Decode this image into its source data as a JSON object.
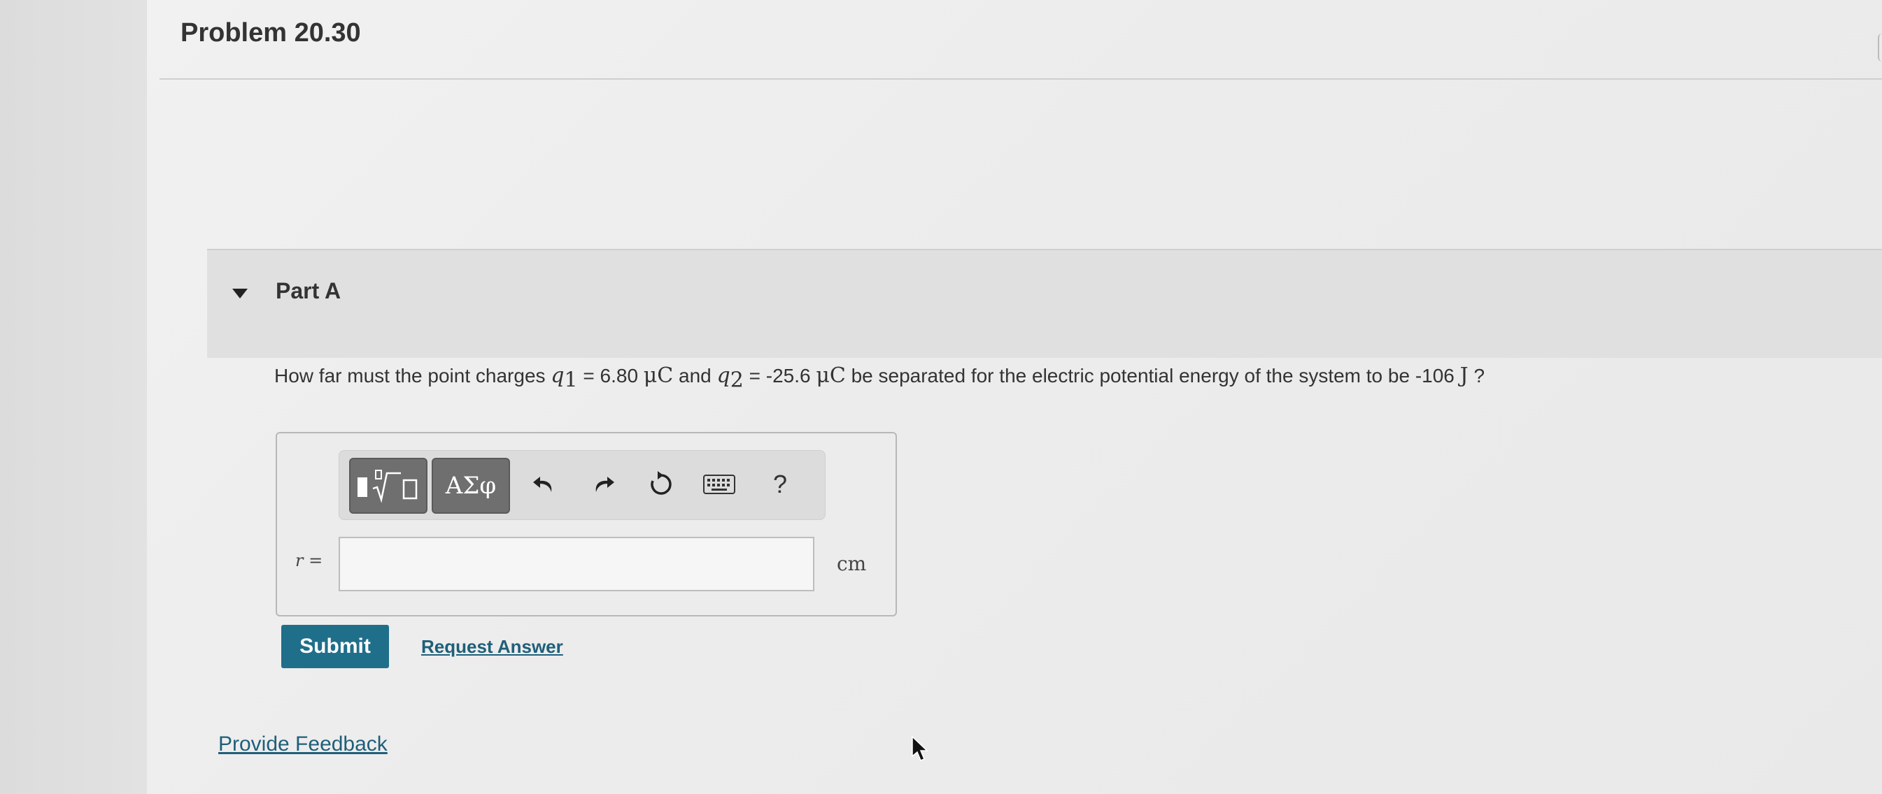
{
  "problem": {
    "title": "Problem 20.30"
  },
  "part": {
    "title": "Part A"
  },
  "question": {
    "intro": "How far must the point charges ",
    "q1_symbol": "q",
    "q1_sub": "1",
    "eq1": " = 6.80 ",
    "unit_mu": "μC",
    "mid": " and ",
    "q2_symbol": "q",
    "q2_sub": "2",
    "eq2": " = -25.6 ",
    "unit_mu2": "μC",
    "tail": " be separated for the electric potential energy of the system to be -106 ",
    "unit_J": "J",
    "end": " ?"
  },
  "toolbar": {
    "greek_label": "ΑΣφ",
    "help_label": "?"
  },
  "answer": {
    "variable": "r",
    "equals": " =",
    "value": "",
    "unit": "cm"
  },
  "actions": {
    "submit_label": "Submit",
    "request_label": "Request Answer",
    "feedback_label": "Provide Feedback"
  },
  "colors": {
    "submit_bg": "#1f6f8b",
    "link": "#1f5f7a"
  }
}
